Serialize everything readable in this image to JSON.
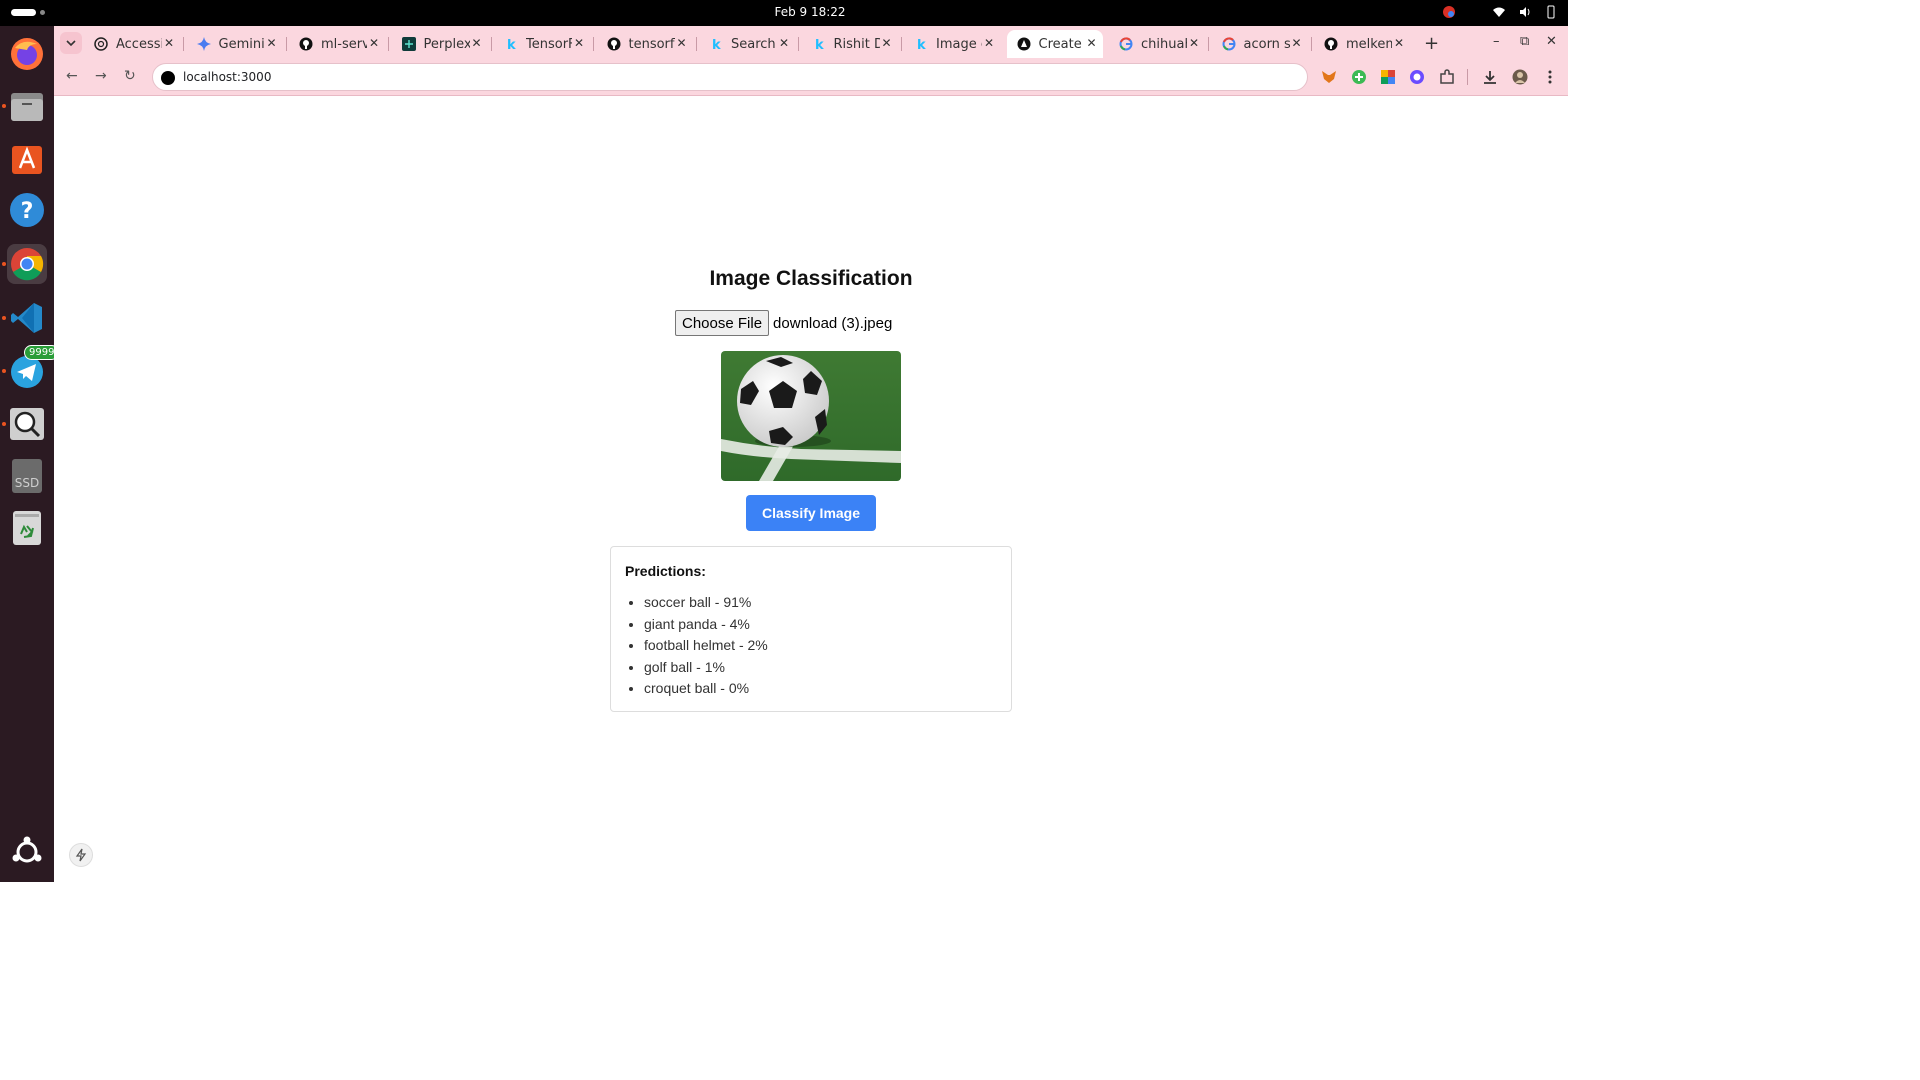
{
  "system": {
    "clock": "Feb 9  18:22"
  },
  "dock": {
    "items": [
      {
        "name": "firefox"
      },
      {
        "name": "files"
      },
      {
        "name": "app-center"
      },
      {
        "name": "help"
      },
      {
        "name": "chrome"
      },
      {
        "name": "vscode"
      },
      {
        "name": "telegram",
        "badge": "9999"
      },
      {
        "name": "search"
      },
      {
        "name": "ssd",
        "label": "SSD"
      },
      {
        "name": "trash"
      },
      {
        "name": "ubuntu"
      }
    ]
  },
  "browser": {
    "tabs": [
      {
        "label": "Accessin",
        "icon": "openai-icon"
      },
      {
        "label": "Gemini",
        "icon": "gemini-icon"
      },
      {
        "label": "ml-servi",
        "icon": "github-icon"
      },
      {
        "label": "Perplexi",
        "icon": "perplexity-icon"
      },
      {
        "label": "TensorF",
        "icon": "kaggle-icon"
      },
      {
        "label": "tensorfl",
        "icon": "github-icon"
      },
      {
        "label": "Search |",
        "icon": "kaggle-icon"
      },
      {
        "label": "Rishit D",
        "icon": "kaggle-icon"
      },
      {
        "label": "Image c",
        "icon": "kaggle-icon"
      },
      {
        "label": "Create I",
        "icon": "nextjs-icon",
        "active": true
      },
      {
        "label": "chihuah",
        "icon": "google-icon"
      },
      {
        "label": "acorn sc",
        "icon": "google-icon"
      },
      {
        "label": "melkem",
        "icon": "github-icon"
      }
    ],
    "url": "localhost:3000"
  },
  "app": {
    "title": "Image Classification",
    "choose_file_label": "Choose File",
    "file_name": "download (3).jpeg",
    "classify_label": "Classify Image",
    "predictions_title": "Predictions:",
    "predictions": [
      {
        "text": "soccer ball - 91%"
      },
      {
        "text": "giant panda - 4%"
      },
      {
        "text": "football helmet - 2%"
      },
      {
        "text": "golf ball - 1%"
      },
      {
        "text": "croquet ball - 0%"
      }
    ]
  },
  "colors": {
    "accent": "#3b82f6",
    "chrome": "#fbd7df",
    "dock": "#2b1a22"
  }
}
